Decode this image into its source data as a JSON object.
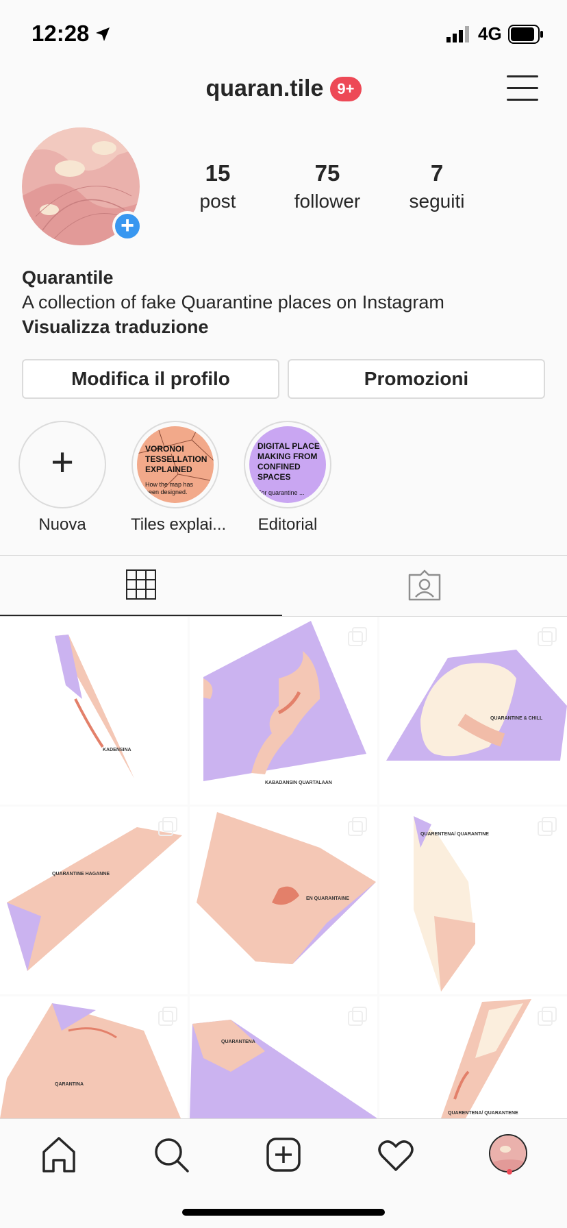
{
  "status_bar": {
    "time": "12:28",
    "network": "4G"
  },
  "header": {
    "username": "quaran.tile",
    "notification_badge": "9+"
  },
  "profile": {
    "stats": [
      {
        "value": "15",
        "label": "post"
      },
      {
        "value": "75",
        "label": "follower"
      },
      {
        "value": "7",
        "label": "seguiti"
      }
    ],
    "name": "Quarantile",
    "bio": "A collection of fake Quarantine places on Instagram",
    "translate_label": "Visualizza traduzione"
  },
  "buttons": {
    "edit_profile": "Modifica il profilo",
    "promotions": "Promozioni"
  },
  "highlights": [
    {
      "label": "Nuova",
      "icon": "plus-icon"
    },
    {
      "label": "Tiles explai...",
      "title": "VORONOI TESSELLATION EXPLAINED",
      "subtitle": "How the map has been designed.",
      "color": "#f2a98a"
    },
    {
      "label": "Editorial",
      "title": "DIGITAL PLACE MAKING FROM CONFINED SPACES",
      "subtitle": "For quarantine ...",
      "color": "#c9a6f2"
    }
  ],
  "tabs": [
    {
      "icon": "grid-icon",
      "active": true
    },
    {
      "icon": "tagged-icon",
      "active": false
    }
  ],
  "posts": [
    {
      "label": "KADENSINA"
    },
    {
      "label": "KABADANSIN QUARTALAAN"
    },
    {
      "label": "QUARANTINE & CHILL"
    },
    {
      "label": "QUARANTINE HAGANNE"
    },
    {
      "label": "EN QUARANTAINE"
    },
    {
      "label": "QUARENTENA/ QUARANTINE"
    },
    {
      "label": "QARANTINA"
    },
    {
      "label": "QUARANTENA"
    },
    {
      "label": "QUARENTENA/ QUARANTENE"
    }
  ],
  "colors": {
    "accent": "#3897f0",
    "badge": "#ed4956",
    "map_land": "#f4c7b5",
    "map_water": "#cbb3f0"
  }
}
